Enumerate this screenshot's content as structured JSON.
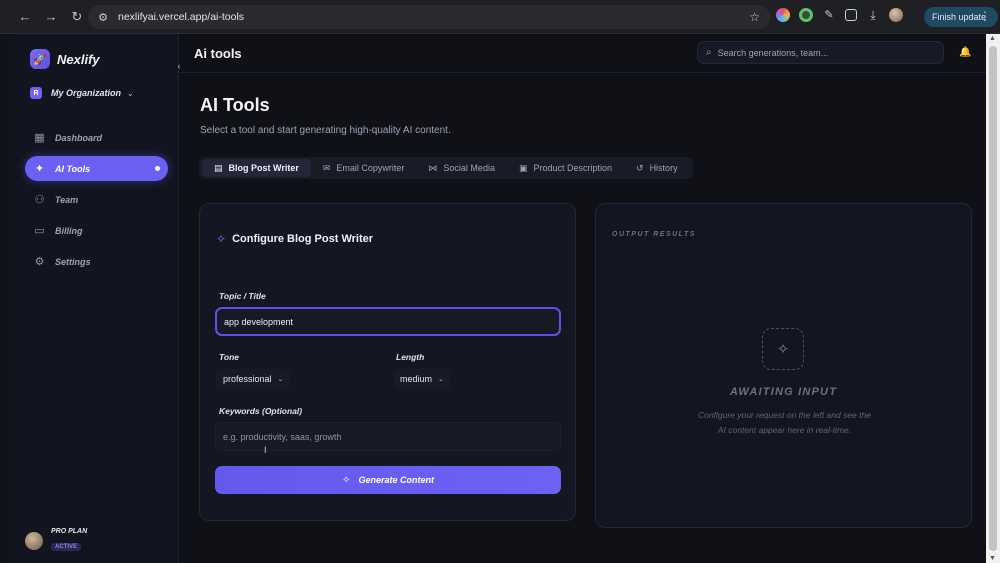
{
  "browser": {
    "url": "nexlifyai.vercel.app/ai-tools",
    "finish_update_label": "Finish update",
    "back_icon": "←",
    "forward_icon": "→",
    "reload_icon": "↻",
    "star_icon": "☆",
    "menu_icon": "⋮"
  },
  "sidebar": {
    "brand": "Nexlify",
    "org_initial": "R",
    "org_name": "My Organization",
    "items": [
      {
        "label": "Dashboard",
        "icon": "▦"
      },
      {
        "label": "AI Tools",
        "icon": "✦"
      },
      {
        "label": "Team",
        "icon": "👥"
      },
      {
        "label": "Billing",
        "icon": "▭"
      },
      {
        "label": "Settings",
        "icon": "⚙"
      }
    ],
    "plan_name": "PRO PLAN",
    "plan_status": "ACTIVE"
  },
  "topbar": {
    "title": "Ai tools",
    "search_placeholder": "Search generations, team..."
  },
  "page": {
    "title": "AI Tools",
    "subtitle": "Select a tool and start generating high-quality AI content."
  },
  "tabs": [
    {
      "label": "Blog Post Writer",
      "icon": "▤"
    },
    {
      "label": "Email Copywriter",
      "icon": "✉"
    },
    {
      "label": "Social Media",
      "icon": "⋈"
    },
    {
      "label": "Product Description",
      "icon": "▣"
    },
    {
      "label": "History",
      "icon": "↺"
    }
  ],
  "config": {
    "title": "Configure Blog Post Writer",
    "topic_label": "Topic / Title",
    "topic_value": "app development",
    "tone_label": "Tone",
    "tone_value": "professional",
    "length_label": "Length",
    "length_value": "medium",
    "keywords_label": "Keywords (Optional)",
    "keywords_placeholder": "e.g. productivity, saas, growth",
    "generate_label": "Generate Content"
  },
  "output": {
    "label": "OUTPUT RESULTS",
    "await_title": "AWAITING INPUT",
    "await_desc": "Configure your request on the left and see the AI content appear here in real-time."
  }
}
